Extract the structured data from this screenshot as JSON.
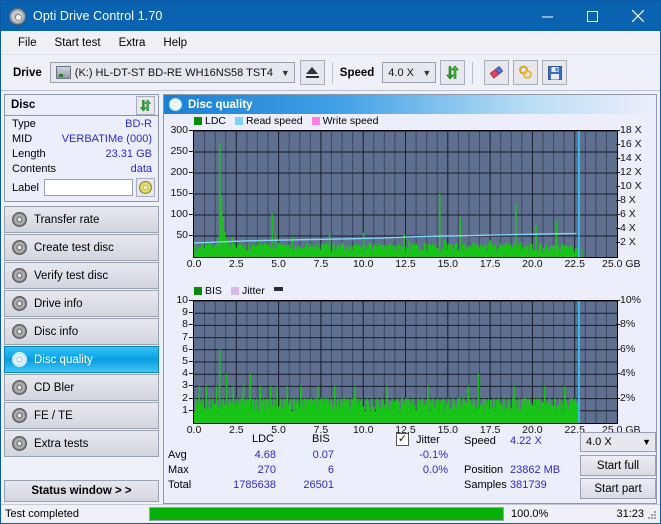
{
  "window": {
    "title": "Opti Drive Control 1.70",
    "icon": "disc-icon",
    "minimize": "minimize-icon",
    "maximize": "maximize-icon",
    "close": "close-icon"
  },
  "menu": {
    "items": [
      {
        "label": "File",
        "name": "menu-file"
      },
      {
        "label": "Start test",
        "name": "menu-start-test"
      },
      {
        "label": "Extra",
        "name": "menu-extra"
      },
      {
        "label": "Help",
        "name": "menu-help"
      }
    ]
  },
  "toolbar": {
    "drive_label": "Drive",
    "drive_value": "(K:)  HL-DT-ST BD-RE  WH16NS58 TST4",
    "eject": "eject-icon",
    "speed_label": "Speed",
    "speed_value": "4.0 X",
    "refresh": "refresh-icon",
    "eraser": "eraser-icon",
    "gold": "gold-icon",
    "save": "save-icon"
  },
  "disc": {
    "title": "Disc",
    "refresh_icon": "refresh-icon",
    "rows": [
      {
        "key": "Type",
        "value": "BD-R"
      },
      {
        "key": "MID",
        "value": "VERBATIMe (000)"
      },
      {
        "key": "Length",
        "value": "23.31 GB"
      },
      {
        "key": "Contents",
        "value": "data"
      }
    ],
    "label_key": "Label",
    "label_value": "",
    "label_placeholder": "",
    "label_button_icon": "cd-icon"
  },
  "sidebar": {
    "items": [
      {
        "label": "Transfer rate",
        "name": "sidebar-item-transfer-rate",
        "active": false
      },
      {
        "label": "Create test disc",
        "name": "sidebar-item-create-test-disc",
        "active": false
      },
      {
        "label": "Verify test disc",
        "name": "sidebar-item-verify-test-disc",
        "active": false
      },
      {
        "label": "Drive info",
        "name": "sidebar-item-drive-info",
        "active": false
      },
      {
        "label": "Disc info",
        "name": "sidebar-item-disc-info",
        "active": false
      },
      {
        "label": "Disc quality",
        "name": "sidebar-item-disc-quality",
        "active": true
      },
      {
        "label": "CD Bler",
        "name": "sidebar-item-cd-bler",
        "active": false
      },
      {
        "label": "FE / TE",
        "name": "sidebar-item-fe-te",
        "active": false
      },
      {
        "label": "Extra tests",
        "name": "sidebar-item-extra-tests",
        "active": false
      }
    ],
    "status_window_label": "Status window > >"
  },
  "main": {
    "title": "Disc quality",
    "icon": "disc-quality-icon"
  },
  "stats": {
    "col_ldc": "LDC",
    "col_bis": "BIS",
    "jitter_label": "Jitter",
    "jitter_checked": true,
    "rows": [
      {
        "name": "Avg",
        "ldc": "4.68",
        "bis": "0.07",
        "jitter": "-0.1%"
      },
      {
        "name": "Max",
        "ldc": "270",
        "bis": "6",
        "jitter": "0.0%"
      },
      {
        "name": "Total",
        "ldc": "1785638",
        "bis": "26501",
        "jitter": ""
      }
    ],
    "speed_label": "Speed",
    "speed_value": "4.22 X",
    "position_label": "Position",
    "position_value": "23862 MB",
    "samples_label": "Samples",
    "samples_value": "381739",
    "speed_select": "4.0 X",
    "start_full": "Start full",
    "start_part": "Start part"
  },
  "statusbar": {
    "text": "Test completed",
    "percent": "100.0%",
    "progress": 100,
    "time": "31:23"
  },
  "colors": {
    "accent": "#0a63b0",
    "ldc": "#19c419",
    "bis": "#19c419",
    "read_speed": "#7fd4f5",
    "write_speed": "#ff7fe0",
    "jitter": "#d9b8e8",
    "plot_bg": "#5f6f90",
    "grid": "#2a3347",
    "value_text": "#2b2bc8",
    "progress": "#06b006"
  },
  "chart_data": [
    {
      "type": "area",
      "name": "disc-quality-ldc",
      "title": "",
      "xlabel": "GB",
      "ylabel": "LDC",
      "xlim": [
        0,
        25
      ],
      "ylim": [
        0,
        300
      ],
      "y2lim": [
        0,
        18
      ],
      "y2label": "X",
      "grid": true,
      "legend": [
        "LDC",
        "Read speed",
        "Write speed"
      ],
      "legend_position": "top-left",
      "xticks": [
        "0.0",
        "2.5",
        "5.0",
        "7.5",
        "10.0",
        "12.5",
        "15.0",
        "17.5",
        "20.0",
        "22.5",
        "25.0 GB"
      ],
      "yticks": [
        50,
        100,
        150,
        200,
        250,
        300
      ],
      "y2ticks": [
        "2 X",
        "4 X",
        "6 X",
        "8 X",
        "10 X",
        "12 X",
        "14 X",
        "16 X",
        "18 X"
      ],
      "series": [
        {
          "name": "LDC",
          "color": "#19c419",
          "x": [
            0.05,
            0.2,
            0.35,
            0.5,
            0.65,
            0.8,
            0.95,
            1.1,
            1.25,
            1.4,
            1.5,
            1.6,
            1.7,
            1.8,
            1.9,
            2.0,
            2.1,
            2.25,
            2.4,
            2.55,
            2.7,
            2.85,
            3.0,
            3.2,
            3.4,
            3.6,
            3.8,
            4.0,
            4.2,
            4.4,
            4.6,
            4.8,
            5.0,
            5.2,
            5.4,
            5.6,
            5.8,
            6.0,
            6.2,
            6.4,
            6.6,
            6.8,
            7.0,
            7.2,
            7.4,
            7.6,
            7.8,
            8.0,
            8.2,
            8.4,
            8.6,
            8.8,
            9.0,
            9.2,
            9.4,
            9.6,
            9.8,
            10.0,
            10.3,
            10.6,
            10.9,
            11.2,
            11.5,
            11.8,
            12.1,
            12.4,
            12.7,
            13.0,
            13.3,
            13.6,
            13.9,
            14.2,
            14.5,
            14.8,
            15.1,
            15.4,
            15.7,
            16.0,
            16.3,
            16.6,
            16.9,
            17.2,
            17.5,
            17.8,
            18.1,
            18.4,
            18.7,
            19.0,
            19.3,
            19.6,
            19.9,
            20.2,
            20.5,
            20.8,
            21.1,
            21.4,
            21.7,
            22.0,
            22.3,
            22.6,
            22.9
          ],
          "values": [
            20,
            18,
            22,
            26,
            20,
            24,
            28,
            22,
            30,
            46,
            270,
            142,
            96,
            60,
            44,
            34,
            28,
            48,
            30,
            26,
            24,
            22,
            30,
            26,
            24,
            22,
            36,
            24,
            22,
            30,
            102,
            56,
            34,
            26,
            30,
            24,
            48,
            28,
            26,
            22,
            24,
            28,
            26,
            30,
            24,
            28,
            34,
            56,
            28,
            24,
            26,
            30,
            24,
            28,
            26,
            30,
            24,
            58,
            30,
            26,
            24,
            30,
            28,
            26,
            32,
            56,
            40,
            26,
            28,
            34,
            30,
            26,
            150,
            40,
            30,
            28,
            96,
            32,
            28,
            34,
            30,
            26,
            40,
            30,
            28,
            34,
            30,
            128,
            36,
            30,
            28,
            74,
            34,
            30,
            28,
            86,
            30,
            28,
            26,
            20,
            18
          ]
        },
        {
          "name": "Read speed",
          "color": "#7fd4f5",
          "x": [
            0.0,
            1.0,
            2.0,
            3.0,
            4.0,
            5.0,
            6.0,
            7.0,
            8.0,
            9.0,
            10.0,
            11.0,
            12.0,
            13.0,
            14.0,
            15.0,
            16.0,
            17.0,
            18.0,
            19.0,
            20.0,
            21.0,
            22.0,
            22.6
          ],
          "values_x_speed": [
            2.0,
            2.1,
            2.2,
            2.3,
            2.35,
            2.4,
            2.45,
            2.5,
            2.55,
            2.6,
            2.65,
            2.7,
            2.8,
            2.9,
            2.95,
            3.0,
            3.05,
            3.1,
            3.15,
            3.2,
            3.25,
            3.3,
            3.35,
            3.35
          ]
        },
        {
          "name": "Write speed",
          "color": "#ff7fe0",
          "x": [],
          "values": []
        }
      ],
      "end_marker_gb": 22.75,
      "end_marker_color": "#35c8f5"
    },
    {
      "type": "area",
      "name": "disc-quality-bis",
      "title": "",
      "xlabel": "GB",
      "ylabel": "BIS",
      "xlim": [
        0,
        25
      ],
      "ylim": [
        0,
        10
      ],
      "y2lim": [
        0,
        10
      ],
      "y2label": "%",
      "grid": true,
      "legend": [
        "BIS",
        "Jitter"
      ],
      "legend_position": "top-left",
      "xticks": [
        "0.0",
        "2.5",
        "5.0",
        "7.5",
        "10.0",
        "12.5",
        "15.0",
        "17.5",
        "20.0",
        "22.5",
        "25.0 GB"
      ],
      "yticks": [
        1,
        2,
        3,
        4,
        5,
        6,
        7,
        8,
        9,
        10
      ],
      "y2ticks": [
        "2%",
        "4%",
        "6%",
        "8%",
        "10%"
      ],
      "series": [
        {
          "name": "BIS",
          "color": "#19c419",
          "x": [
            0.1,
            0.3,
            0.5,
            0.7,
            0.9,
            1.1,
            1.3,
            1.5,
            1.7,
            1.9,
            2.1,
            2.3,
            2.5,
            2.7,
            2.9,
            3.1,
            3.3,
            3.5,
            3.7,
            3.9,
            4.1,
            4.3,
            4.5,
            4.7,
            4.9,
            5.1,
            5.3,
            5.5,
            5.7,
            5.9,
            6.1,
            6.3,
            6.5,
            6.7,
            6.9,
            7.1,
            7.3,
            7.5,
            7.7,
            7.9,
            8.1,
            8.3,
            8.5,
            8.7,
            8.9,
            9.1,
            9.3,
            9.5,
            9.7,
            9.9,
            10.2,
            10.5,
            10.8,
            11.1,
            11.4,
            11.7,
            12.0,
            12.3,
            12.6,
            12.9,
            13.2,
            13.5,
            13.8,
            14.1,
            14.4,
            14.7,
            15.0,
            15.3,
            15.6,
            15.9,
            16.2,
            16.5,
            16.8,
            17.1,
            17.4,
            17.7,
            18.0,
            18.3,
            18.6,
            18.9,
            19.2,
            19.5,
            19.8,
            20.1,
            20.4,
            20.7,
            21.0,
            21.3,
            21.6,
            21.9,
            22.2,
            22.5,
            22.7
          ],
          "values": [
            2,
            3,
            2,
            3,
            2,
            2,
            3,
            6,
            2,
            4,
            2,
            3,
            2,
            2,
            3,
            2,
            4,
            2,
            2,
            3,
            2,
            2,
            3,
            2,
            3,
            2,
            2,
            3,
            2,
            2,
            2,
            3,
            2,
            2,
            2,
            2,
            3,
            2,
            2,
            2,
            2,
            3,
            2,
            2,
            2,
            2,
            2,
            3,
            2,
            2,
            2,
            2,
            2,
            2,
            3,
            2,
            2,
            2,
            2,
            2,
            2,
            2,
            3,
            2,
            2,
            2,
            2,
            2,
            2,
            2,
            3,
            2,
            4,
            2,
            2,
            2,
            2,
            2,
            2,
            3,
            2,
            2,
            2,
            2,
            2,
            3,
            2,
            2,
            2,
            3,
            2,
            2,
            2
          ]
        },
        {
          "name": "Jitter",
          "color": "#d9b8e8",
          "x": [],
          "values": []
        }
      ],
      "end_marker_gb": 22.75,
      "end_marker_color": "#35c8f5"
    }
  ]
}
